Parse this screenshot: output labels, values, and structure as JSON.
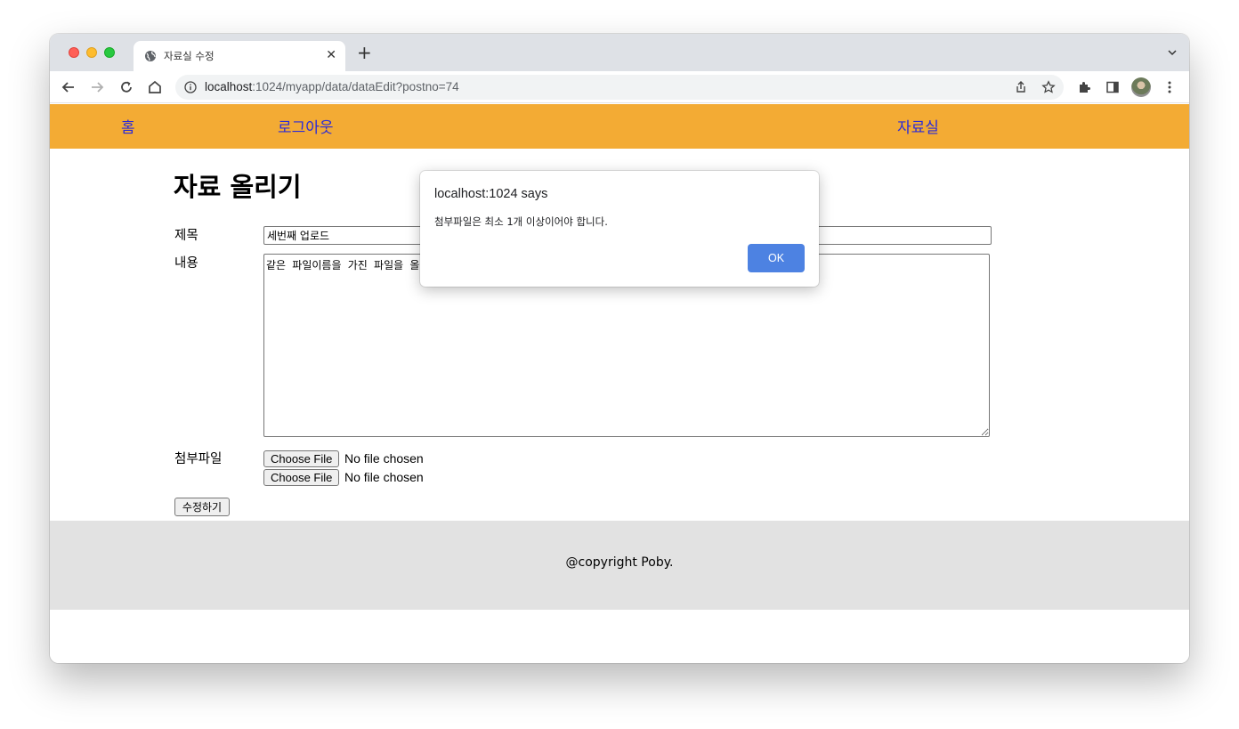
{
  "browser": {
    "tab_title": "자료실 수정",
    "url_host": "localhost",
    "url_path": ":1024/myapp/data/dataEdit?postno=74",
    "accent_color": "#4d82e2"
  },
  "nav": {
    "items": [
      {
        "label": "홈"
      },
      {
        "label": "로그아웃"
      },
      {
        "label": "자료실"
      }
    ],
    "bar_color": "#f3ab34",
    "link_color": "#2b2bd8"
  },
  "form": {
    "heading": "자료 올리기",
    "title_label": "제목",
    "title_value": "세번째 업로드",
    "content_label": "내용",
    "content_value": "같은 파일이름을 가진 파일을 올려봅시다.",
    "attach_label": "첨부파일",
    "files": [
      {
        "button": "Choose File",
        "status": "No file chosen"
      },
      {
        "button": "Choose File",
        "status": "No file chosen"
      }
    ],
    "submit_label": "수정하기"
  },
  "footer": {
    "text": "@copyright Poby."
  },
  "dialog": {
    "title": "localhost:1024 says",
    "message": "첨부파일은 최소 1개 이상이어야 합니다.",
    "ok_label": "OK"
  }
}
